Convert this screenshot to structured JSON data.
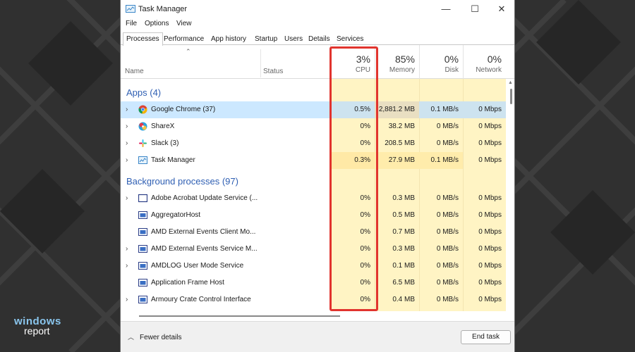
{
  "window": {
    "title": "Task Manager"
  },
  "window_controls": {
    "minimize": "—",
    "maximize": "☐",
    "close": "✕"
  },
  "menu": [
    "File",
    "Options",
    "View"
  ],
  "tabs": [
    "Processes",
    "Performance",
    "App history",
    "Startup",
    "Users",
    "Details",
    "Services"
  ],
  "active_tab": "Processes",
  "columns": {
    "name": "Name",
    "status": "Status",
    "cpu": {
      "pct": "3%",
      "label": "CPU"
    },
    "memory": {
      "pct": "85%",
      "label": "Memory"
    },
    "disk": {
      "pct": "0%",
      "label": "Disk"
    },
    "network": {
      "pct": "0%",
      "label": "Network"
    }
  },
  "groups": {
    "apps": "Apps (4)",
    "background": "Background processes (97)"
  },
  "apps": [
    {
      "name": "Google Chrome (37)",
      "cpu": "0.5%",
      "memory": "2,881.2 MB",
      "disk": "0.1 MB/s",
      "network": "0 Mbps",
      "icon": "chrome-icon",
      "expandable": true,
      "selected": true
    },
    {
      "name": "ShareX",
      "cpu": "0%",
      "memory": "38.2 MB",
      "disk": "0 MB/s",
      "network": "0 Mbps",
      "icon": "sharex-icon",
      "expandable": true
    },
    {
      "name": "Slack (3)",
      "cpu": "0%",
      "memory": "208.5 MB",
      "disk": "0 MB/s",
      "network": "0 Mbps",
      "icon": "slack-icon",
      "expandable": true
    },
    {
      "name": "Task Manager",
      "cpu": "0.3%",
      "memory": "27.9 MB",
      "disk": "0.1 MB/s",
      "network": "0 Mbps",
      "icon": "task-manager-icon",
      "expandable": true
    }
  ],
  "background": [
    {
      "name": "Adobe Acrobat Update Service (...",
      "cpu": "0%",
      "memory": "0.3 MB",
      "disk": "0 MB/s",
      "network": "0 Mbps",
      "icon": "window-icon",
      "expandable": true
    },
    {
      "name": "AggregatorHost",
      "cpu": "0%",
      "memory": "0.5 MB",
      "disk": "0 MB/s",
      "network": "0 Mbps",
      "icon": "app-icon",
      "expandable": false
    },
    {
      "name": "AMD External Events Client Mo...",
      "cpu": "0%",
      "memory": "0.7 MB",
      "disk": "0 MB/s",
      "network": "0 Mbps",
      "icon": "app-icon",
      "expandable": false
    },
    {
      "name": "AMD External Events Service M...",
      "cpu": "0%",
      "memory": "0.3 MB",
      "disk": "0 MB/s",
      "network": "0 Mbps",
      "icon": "app-icon",
      "expandable": true
    },
    {
      "name": "AMDLOG User Mode Service",
      "cpu": "0%",
      "memory": "0.1 MB",
      "disk": "0 MB/s",
      "network": "0 Mbps",
      "icon": "app-icon",
      "expandable": true
    },
    {
      "name": "Application Frame Host",
      "cpu": "0%",
      "memory": "6.5 MB",
      "disk": "0 MB/s",
      "network": "0 Mbps",
      "icon": "app-icon",
      "expandable": false
    },
    {
      "name": "Armoury Crate Control Interface",
      "cpu": "0%",
      "memory": "0.4 MB",
      "disk": "0 MB/s",
      "network": "0 Mbps",
      "icon": "app-icon",
      "expandable": true
    }
  ],
  "footer": {
    "fewer_details": "Fewer details",
    "end_task": "End task"
  },
  "watermark": {
    "line1": "windows",
    "line2": "report"
  },
  "colors": {
    "heat_light": "#fff4c4",
    "heat_medium": "#ffecab",
    "heat_memory_high": "#fbdf9a",
    "selection": "#cce8ff",
    "highlight_box": "#e1342e",
    "group_text": "#2f5fb3"
  }
}
